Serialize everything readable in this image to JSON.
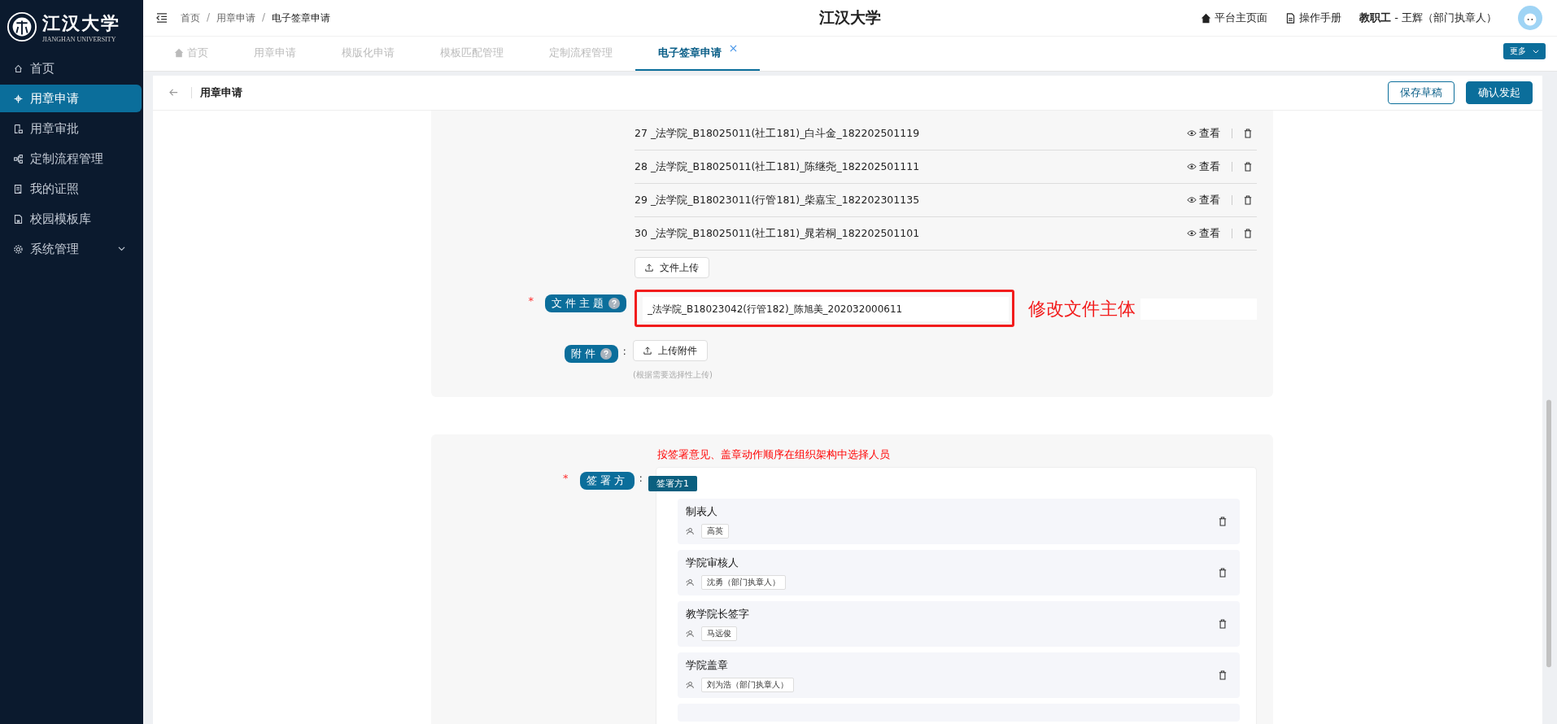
{
  "sidebar": {
    "logo": {
      "name": "江汉大学",
      "subtitle": "JIANGHAN UNIVERSITY"
    },
    "items": [
      {
        "label": "首页",
        "selected": false,
        "submenu": false
      },
      {
        "label": "用章申请",
        "selected": true,
        "submenu": false
      },
      {
        "label": "用章审批",
        "selected": false,
        "submenu": false
      },
      {
        "label": "定制流程管理",
        "selected": false,
        "submenu": false
      },
      {
        "label": "我的证照",
        "selected": false,
        "submenu": false
      },
      {
        "label": "校园模板库",
        "selected": false,
        "submenu": false
      },
      {
        "label": "系统管理",
        "selected": false,
        "submenu": true
      }
    ]
  },
  "header": {
    "separator": "/",
    "breadcrumb": [
      "首页",
      "用章申请",
      "电子签章申请"
    ],
    "title": "江汉大学",
    "links": [
      "平台主页面",
      "操作手册"
    ],
    "user": {
      "role": "教职工",
      "name": " - 王辉（部门执章人）"
    }
  },
  "tabs": [
    {
      "label": "首页",
      "selected": false
    },
    {
      "label": "用章申请",
      "selected": false
    },
    {
      "label": "模版化申请",
      "selected": false
    },
    {
      "label": "模板匹配管理",
      "selected": false
    },
    {
      "label": "定制流程管理",
      "selected": false
    },
    {
      "label": "电子签章申请",
      "selected": true
    }
  ],
  "more_button": "更多",
  "page": {
    "title": "用章申请",
    "buttons": [
      {
        "label": "保存草稿",
        "kind": "outline"
      },
      {
        "label": "确认发起",
        "kind": "primary"
      }
    ]
  },
  "files": {
    "rows": [
      {
        "name": "27 _法学院_B18025011(社工181)_白斗金_182202501119",
        "view": "查看"
      },
      {
        "name": "28 _法学院_B18025011(社工181)_陈继尧_182202501111",
        "view": "查看"
      },
      {
        "name": "29 _法学院_B18023011(行管181)_柴嘉宝_182202301135",
        "view": "查看"
      },
      {
        "name": "30 _法学院_B18025011(社工181)_晁若桐_182202501101",
        "view": "查看"
      }
    ],
    "upload": "文件上传"
  },
  "subject": {
    "label": "文件主题",
    "required_mark": "*",
    "value": "_法学院_B18023042(行管182)_陈旭美_202032000611",
    "annotation": "修改文件主体"
  },
  "attachment": {
    "label": "附件",
    "colon": ":",
    "button": "上传附件",
    "hint": "(根据需要选择性上传)"
  },
  "signers": {
    "hint": "按签署意见、盖章动作顺序在组织架构中选择人员",
    "label": "签署方",
    "required_mark": "*",
    "colon": ":",
    "party": "签署方1",
    "steps": [
      {
        "title": "制表人",
        "people": [
          "高英"
        ]
      },
      {
        "title": "学院审核人",
        "people": [
          "沈勇（部门执章人）"
        ]
      },
      {
        "title": "教学院长签字",
        "people": [
          "马远俊"
        ]
      },
      {
        "title": "学院盖章",
        "people": [
          "刘为浩（部门执章人）"
        ]
      }
    ]
  }
}
